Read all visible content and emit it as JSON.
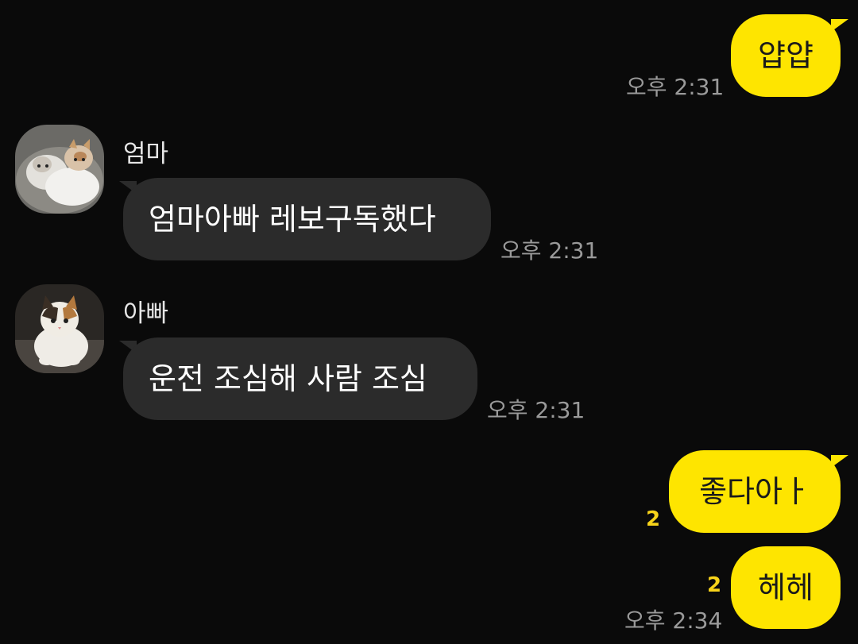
{
  "messages": [
    {
      "sender": "me",
      "text": "얍얍",
      "time": "오후 2:31"
    },
    {
      "sender": "엄마",
      "text": "엄마아빠 레보구독했다",
      "time": "오후 2:31"
    },
    {
      "sender": "아빠",
      "text": "운전 조심해 사람 조심",
      "time": "오후 2:31"
    },
    {
      "sender": "me",
      "text": "좋다아ㅏ",
      "unread": "2"
    },
    {
      "sender": "me",
      "text": "헤헤",
      "unread": "2",
      "time": "오후 2:34"
    }
  ],
  "avatars": {
    "mom": "cat-kittens-avatar",
    "dad": "cat-calico-avatar"
  },
  "colors": {
    "background": "#0a0a0a",
    "my_bubble": "#fee500",
    "their_bubble": "#2b2b2b",
    "unread": "#f7d31a",
    "time": "#9a9a9a"
  }
}
